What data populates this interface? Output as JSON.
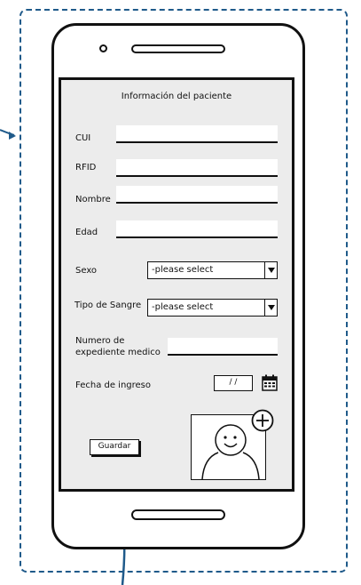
{
  "form": {
    "title": "Información del paciente",
    "labels": {
      "cui": "CUI",
      "rfid": "RFID",
      "nombre": "Nombre",
      "edad": "Edad",
      "sexo": "Sexo",
      "tipo_sangre": "Tipo de Sangre",
      "expediente_line1": "Numero de",
      "expediente_line2": "expediente medico",
      "fecha": "Fecha de ingreso"
    },
    "selects": {
      "sexo": "-please select",
      "tipo_sangre": "-please select"
    },
    "date_value": "/ /",
    "save_label": "Guardar"
  },
  "icons": {
    "calendar": "calendar-icon",
    "add": "plus-circle-icon",
    "avatar": "user-avatar-icon",
    "dropdown": "chevron-down-icon"
  },
  "colors": {
    "annotation": "#1f5a8a",
    "screen_bg": "#ececec"
  }
}
